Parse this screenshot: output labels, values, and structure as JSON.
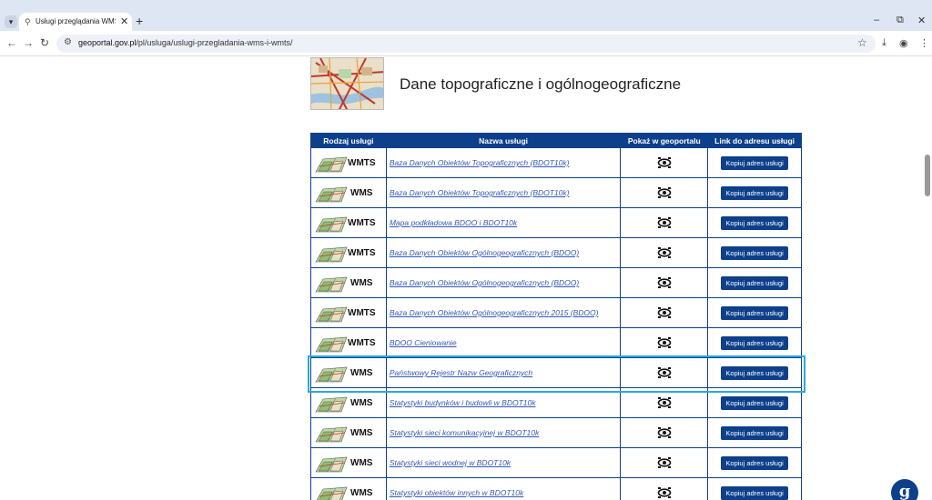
{
  "browser": {
    "tab_title": "Usługi przeglądania WMS i WM",
    "tab_close": "✕",
    "new_tab": "+",
    "url_host": "geoportal.gov.pl",
    "url_path": "/pl/usluga/uslugi-przegladania-wms-i-wmts/"
  },
  "section": {
    "title": "Dane topograficzne i ogólnogeograficzne"
  },
  "table": {
    "headers": [
      "Rodzaj usługi",
      "Nazwa usługi",
      "Pokaż w geoportalu",
      "Link do adresu usługi"
    ],
    "rows": [
      {
        "type": "WMTS",
        "name": "Baza Danych Obiektów Topograficznych (BDOT10k)",
        "button": "Kopiuj adres usługi"
      },
      {
        "type": "WMS",
        "name": "Baza Danych Obiektów Topograficznych (BDOT10k)",
        "button": "Kopiuj adres usługi"
      },
      {
        "type": "WMTS",
        "name": "Mapa podkładowa BDOO i BDOT10k",
        "button": "Kopiuj adres usługi"
      },
      {
        "type": "WMTS",
        "name": "Baza Danych Obiektów Ogólnogeograficznych (BDOO)",
        "button": "Kopiuj adres usługi"
      },
      {
        "type": "WMS",
        "name": "Baza Danych Obiektów Ogólnogeograficznych (BDOO)",
        "button": "Kopiuj adres usługi"
      },
      {
        "type": "WMTS",
        "name": "Baza Danych Obiektów Ogólnogeograficznych 2015 (BDOO)",
        "button": "Kopiuj adres usługi"
      },
      {
        "type": "WMTS",
        "name": "BDOO Cieniowanie",
        "button": "Kopiuj adres usługi"
      },
      {
        "type": "WMS",
        "name": "Państwowy Rejestr Nazw Geograficznych",
        "button": "Kopiuj adres usługi"
      },
      {
        "type": "WMS",
        "name": "Statystyki budynków i budowli w BDOT10k",
        "button": "Kopiuj adres usługi"
      },
      {
        "type": "WMS",
        "name": "Statystyki sieci komunikacyjnej w BDOT10k",
        "button": "Kopiuj adres usługi"
      },
      {
        "type": "WMS",
        "name": "Statystyki sieci wodnej w BDOT10k",
        "button": "Kopiuj adres usługi"
      },
      {
        "type": "WMS",
        "name": "Statystyki obiektów innych w BDOT10k",
        "button": "Kopiuj adres usługi"
      }
    ]
  },
  "colors": {
    "header_bg": "#0d3f8b",
    "link": "#3559b3",
    "highlight": "#29a8e0"
  }
}
